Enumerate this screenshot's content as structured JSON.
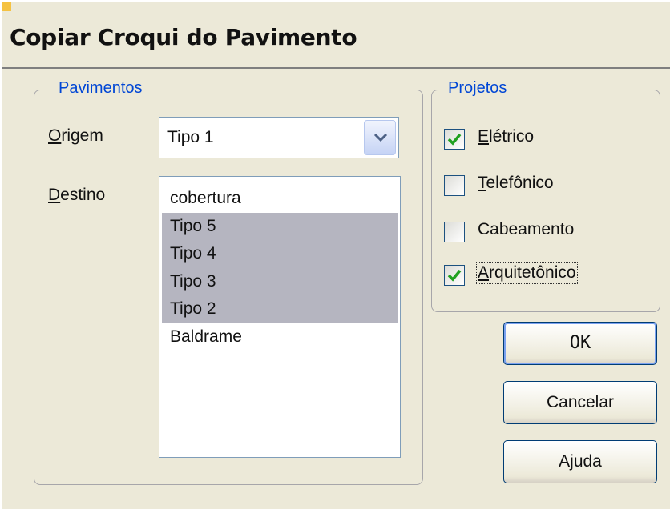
{
  "dialog": {
    "title": "Copiar Croqui do Pavimento"
  },
  "pavimentos": {
    "legend": "Pavimentos",
    "origem_label": "Origem",
    "origem_value": "Tipo 1",
    "destino_label": "Destino",
    "destino_items": [
      {
        "label": "cobertura",
        "selected": false
      },
      {
        "label": "Tipo 5",
        "selected": true
      },
      {
        "label": "Tipo 4",
        "selected": true
      },
      {
        "label": "Tipo 3",
        "selected": true
      },
      {
        "label": "Tipo 2",
        "selected": true
      },
      {
        "label": "Baldrame",
        "selected": false
      }
    ]
  },
  "projetos": {
    "legend": "Projetos",
    "items": [
      {
        "label": "Elétrico",
        "checked": true
      },
      {
        "label": "Telefônico",
        "checked": false
      },
      {
        "label": "Cabeamento",
        "checked": false
      },
      {
        "label": "Arquitetônico",
        "checked": true
      }
    ]
  },
  "buttons": {
    "ok": "OK",
    "cancel": "Cancelar",
    "help": "Ajuda"
  },
  "colors": {
    "background": "#ece9d8",
    "legend": "#0046d5",
    "selection": "#b5b5c0",
    "check": "#21a121"
  }
}
